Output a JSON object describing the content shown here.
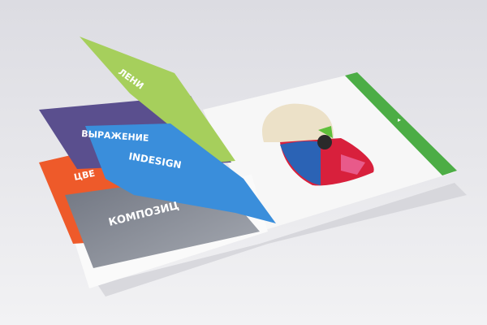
{
  "tabs": [
    {
      "label": "ЛЕНИ",
      "color": "#a6cf5c"
    },
    {
      "label": "ВЫРАЖЕНИЕ",
      "color": "#5a4f8e"
    },
    {
      "label": "INDESIGN",
      "color": "#3a8edb"
    },
    {
      "label": "ЦВЕ",
      "color": "#ee5a2a"
    },
    {
      "label": "КОМПОЗИЦ",
      "color": "#8a8f99"
    }
  ],
  "right_page": {
    "tab_color": "#4cad45",
    "tab_glyph": "▸"
  },
  "background": "#e6e6ea"
}
